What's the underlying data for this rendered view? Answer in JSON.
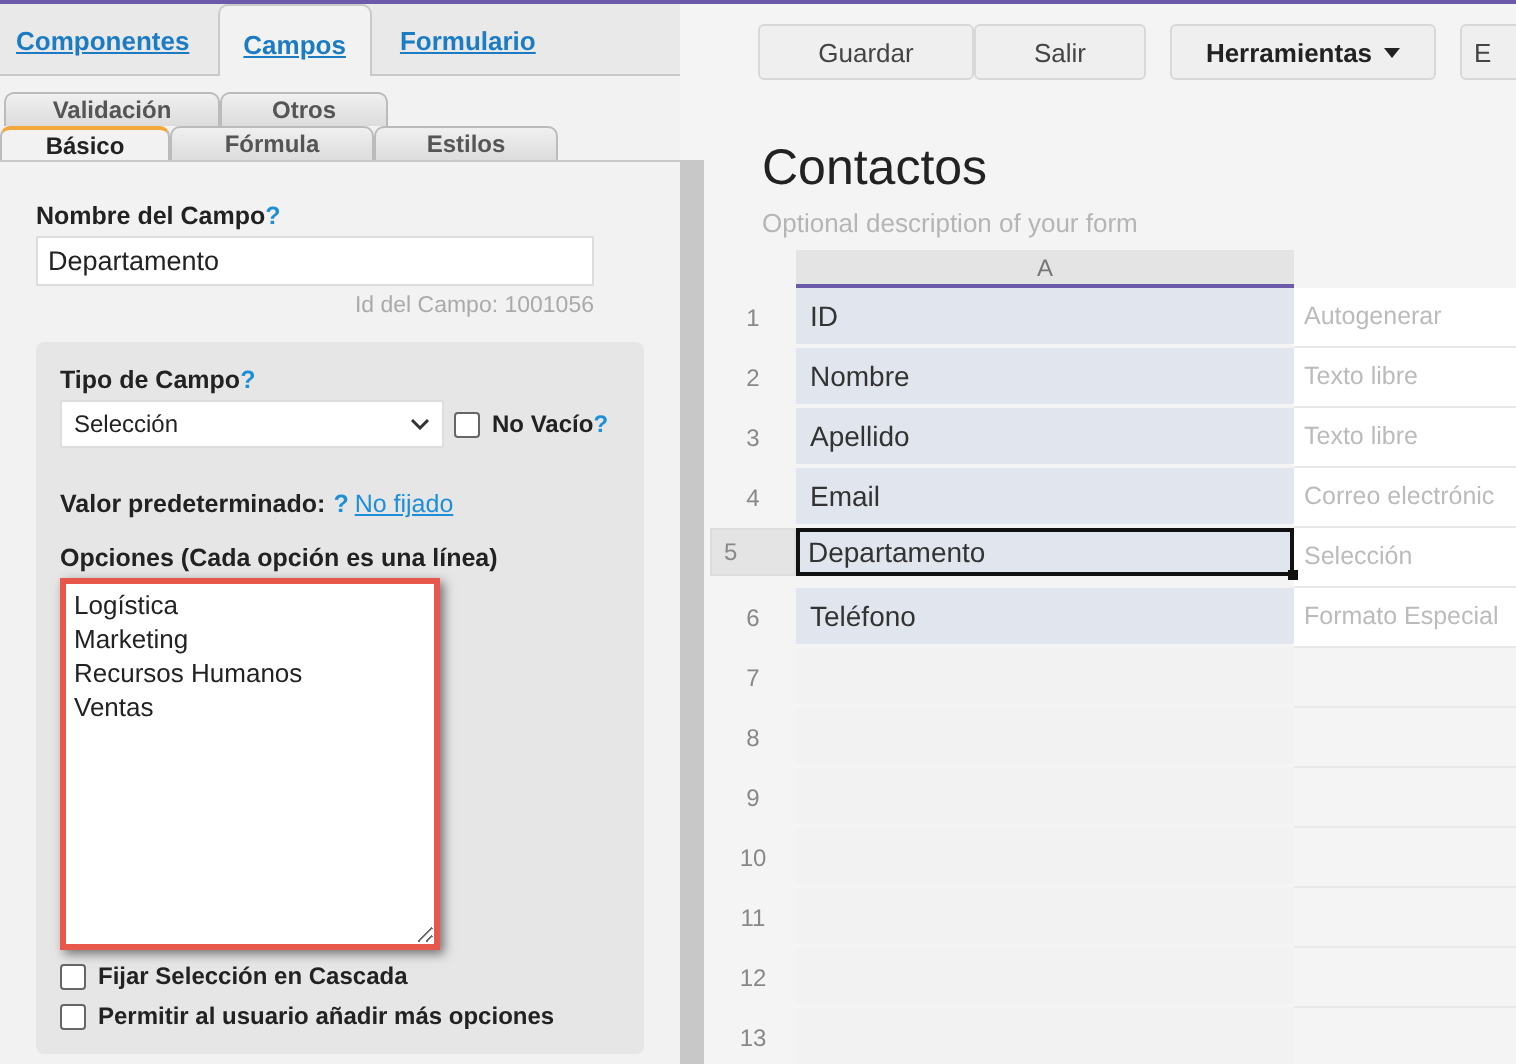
{
  "top_tabs": [
    {
      "label": "Componentes",
      "selected": false
    },
    {
      "label": "Campos",
      "selected": true
    },
    {
      "label": "Formulario",
      "selected": false
    }
  ],
  "sub_tabs": [
    [
      {
        "label": "Validación",
        "selected": false
      },
      {
        "label": "Otros",
        "selected": false
      }
    ],
    [
      {
        "label": "Básico",
        "selected": true
      },
      {
        "label": "Fórmula",
        "selected": false
      },
      {
        "label": "Estilos",
        "selected": false
      }
    ]
  ],
  "field_name": {
    "label": "Nombre del Campo",
    "help": "?",
    "value": "Departamento",
    "id_text": "Id del Campo: 1001056"
  },
  "field_type": {
    "label": "Tipo de Campo",
    "help": "?",
    "value": "Selección"
  },
  "required": {
    "label": "No Vacío",
    "help": "?",
    "checked": false
  },
  "default_value": {
    "label": "Valor predeterminado:",
    "help": "?",
    "link": "No fijado"
  },
  "options": {
    "label": "Opciones (Cada opción es una línea)",
    "highlighted": true,
    "lines": [
      "Logística",
      "Marketing",
      "Recursos Humanos",
      "Ventas"
    ]
  },
  "checkboxes": [
    {
      "label": "Fijar Selección en Cascada",
      "checked": false
    },
    {
      "label": "Permitir al usuario añadir más opciones",
      "checked": false
    }
  ],
  "toolbar": [
    {
      "label": "Guardar",
      "kind": "plain"
    },
    {
      "label": "Salir",
      "kind": "plain"
    },
    {
      "label": "Herramientas",
      "kind": "dropdown"
    },
    {
      "label": "E",
      "kind": "plain"
    }
  ],
  "form": {
    "title": "Contactos",
    "description": "Optional description of your form"
  },
  "sheet": {
    "columns": [
      "A"
    ],
    "rows": [
      {
        "number": "1",
        "column_a": "ID",
        "column_b": "Autogenerar",
        "selected": false
      },
      {
        "number": "2",
        "column_a": "Nombre",
        "column_b": "Texto libre",
        "selected": false
      },
      {
        "number": "3",
        "column_a": "Apellido",
        "column_b": "Texto libre",
        "selected": false
      },
      {
        "number": "4",
        "column_a": "Email",
        "column_b": "Correo electrónic",
        "selected": false
      },
      {
        "number": "5",
        "column_a": "Departamento",
        "column_b": "Selección",
        "selected": true
      },
      {
        "number": "6",
        "column_a": "Teléfono",
        "column_b": "Formato Especial",
        "selected": false
      },
      {
        "number": "7"
      },
      {
        "number": "8"
      },
      {
        "number": "9"
      },
      {
        "number": "10"
      },
      {
        "number": "11"
      },
      {
        "number": "12"
      },
      {
        "number": "13"
      }
    ]
  }
}
